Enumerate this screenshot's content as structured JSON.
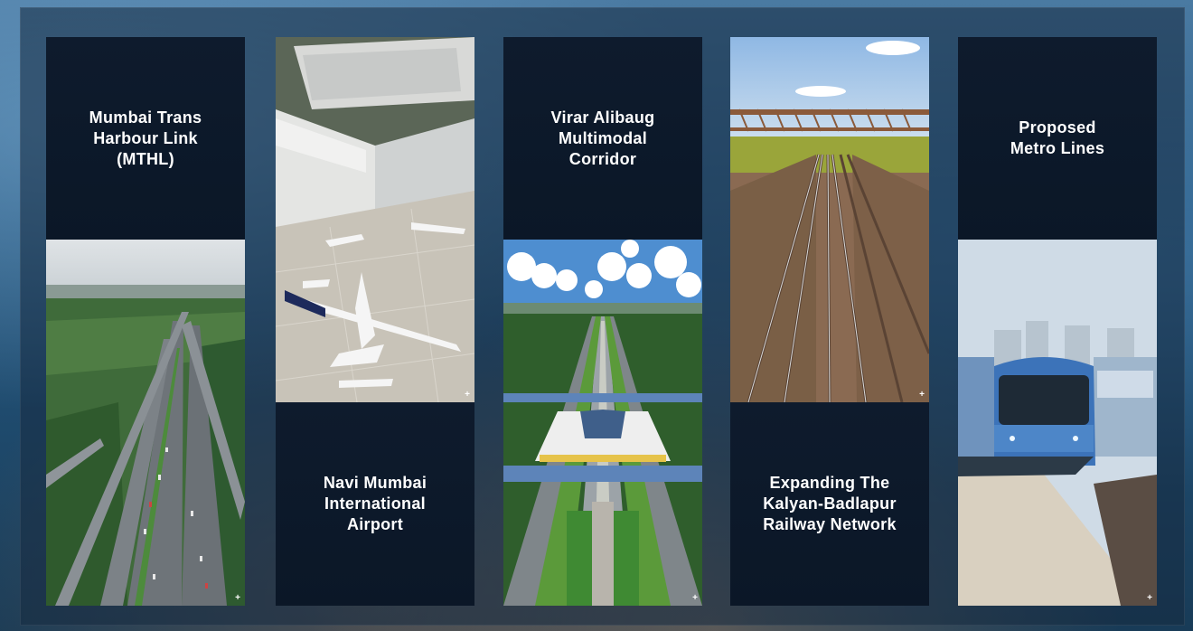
{
  "cards": [
    {
      "title": "Mumbai Trans\nHarbour Link\n(MTHL)",
      "expand_symbol": "+",
      "image_icon": "highway-interchange-image"
    },
    {
      "title": "Navi Mumbai\nInternational\nAirport",
      "expand_symbol": "+",
      "image_icon": "airport-apron-image"
    },
    {
      "title": "Virar Alibaug\nMultimodal\nCorridor",
      "expand_symbol": "+",
      "image_icon": "multimodal-corridor-image"
    },
    {
      "title": "Expanding The\nKalyan-Badlapur\nRailway Network",
      "expand_symbol": "+",
      "image_icon": "railway-tracks-image"
    },
    {
      "title": "Proposed\nMetro Lines",
      "expand_symbol": "+",
      "image_icon": "metro-train-image"
    }
  ],
  "colors": {
    "panel": "#0e1b2d",
    "text": "#ffffff",
    "frame": "#1f3f5e"
  }
}
